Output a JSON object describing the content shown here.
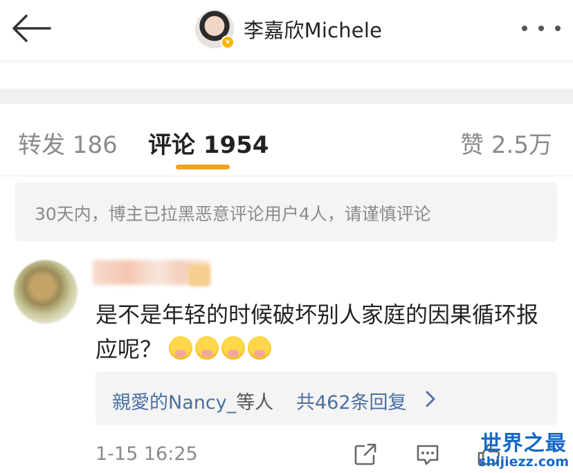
{
  "header": {
    "user_name": "李嘉欣Michele",
    "verified_mark": "v"
  },
  "tabs": {
    "repost": "转发 186",
    "comments": "评论 1954",
    "likes": "赞 2.5万"
  },
  "notice": "30天内，博主已拉黑恶意评论用户4人，请谨慎评论",
  "comment": {
    "text": "是不是年轻的时候破坏别人家庭的因果循环报应呢？",
    "emoji_count": 4,
    "replies": {
      "user": "親愛的Nancy_",
      "suffix": "等人",
      "count": "共462条回复"
    },
    "timestamp": "1-15 16:25"
  },
  "watermark": {
    "title": "世界之最",
    "url": "shijiezz.com"
  },
  "colors": {
    "accent": "#f3a21b",
    "link": "#4a6fa0",
    "muted": "#8a8a8a",
    "verified": "#f7b500",
    "watermark": "#1768c7"
  }
}
